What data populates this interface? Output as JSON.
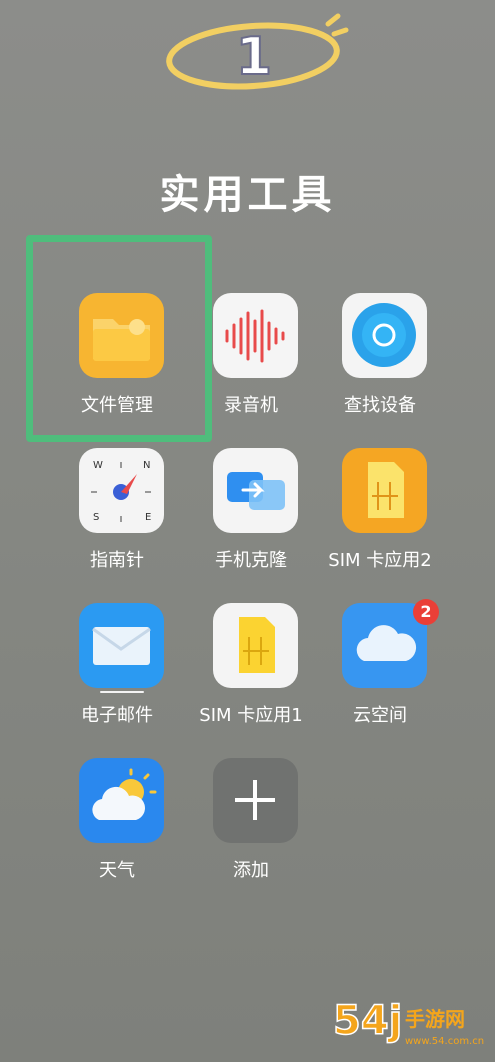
{
  "annotation": {
    "number": "1"
  },
  "folder": {
    "title": "实用工具"
  },
  "apps": [
    {
      "label": "文件管理",
      "icon": "file-manager-icon"
    },
    {
      "label": "录音机",
      "icon": "recorder-icon"
    },
    {
      "label": "查找设备",
      "icon": "find-device-icon"
    },
    {
      "label": "指南针",
      "icon": "compass-icon"
    },
    {
      "label": "手机克隆",
      "icon": "phone-clone-icon"
    },
    {
      "label": "SIM 卡应用2",
      "icon": "sim-card-icon"
    },
    {
      "label": "电子邮件",
      "icon": "email-icon"
    },
    {
      "label": "SIM 卡应用1",
      "icon": "sim-card-icon"
    },
    {
      "label": "云空间",
      "icon": "cloud-icon",
      "badge": "2"
    },
    {
      "label": "天气",
      "icon": "weather-icon"
    },
    {
      "label": "添加",
      "icon": "add-icon"
    }
  ],
  "watermark": {
    "brand": "54j",
    "text": "手游网",
    "url": "www.54.com.cn"
  },
  "colors": {
    "highlight": "#4fbd7c",
    "annotation": "#f2cf62",
    "badge": "#ea3f37"
  }
}
